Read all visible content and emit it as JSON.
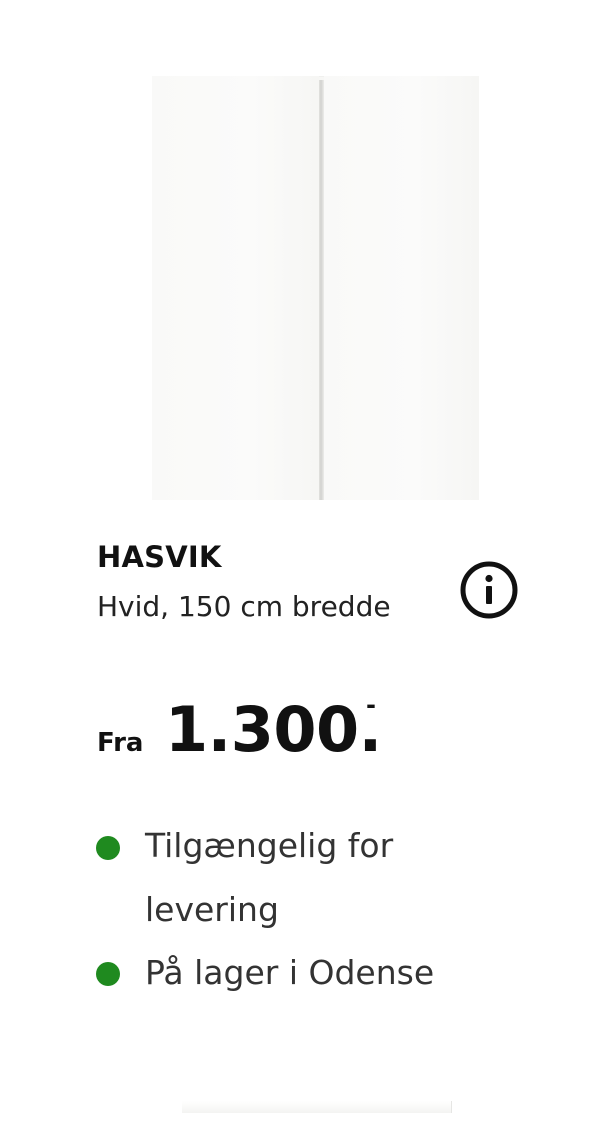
{
  "product": {
    "name": "HASVIK",
    "description": "Hvid, 150 cm bredde",
    "image_icon": "sliding-doors-product-image"
  },
  "price": {
    "prefix": "Fra",
    "amount": "1.300.",
    "suffix": "-"
  },
  "info": {
    "icon": "info-icon"
  },
  "availability": [
    {
      "text": "Tilgængelig for levering",
      "color": "#1f8a1f"
    },
    {
      "text": "På lager i Odense",
      "color": "#1f8a1f"
    }
  ],
  "colors": {
    "text": "#111111",
    "status_green": "#1f8a1f"
  }
}
